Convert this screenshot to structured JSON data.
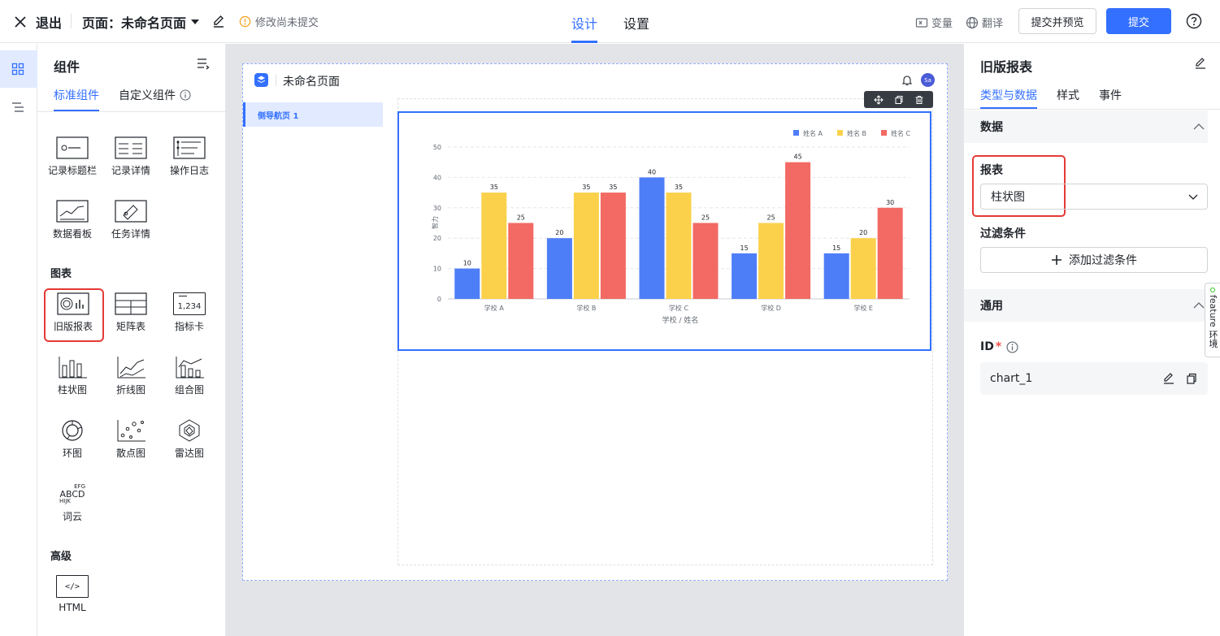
{
  "topbar": {
    "exit_label": "退出",
    "page_prefix": "页面：",
    "page_name": "未命名页面",
    "unsaved": "修改尚未提交",
    "tabs": [
      "设计",
      "设置"
    ],
    "variables": "变量",
    "translate": "翻译",
    "submit_preview": "提交并预览",
    "submit": "提交"
  },
  "left": {
    "title": "组件",
    "tabs": [
      "标准组件",
      "自定义组件"
    ],
    "basic": [
      "记录标题栏",
      "记录详情",
      "操作日志",
      "数据看板",
      "任务详情"
    ],
    "chart_section": "图表",
    "charts": [
      "旧版报表",
      "矩阵表",
      "指标卡",
      "柱状图",
      "折线图",
      "组合图",
      "环图",
      "散点图",
      "雷达图",
      "词云"
    ],
    "advanced_section": "高级",
    "advanced": [
      "HTML"
    ],
    "indicator_text": "1,234",
    "wordcloud_text": [
      "EFG",
      "ABCD",
      "HIJK"
    ],
    "html_icon_text": "</>"
  },
  "canvas": {
    "page_title": "未命名页面",
    "nav_item": "侧导航页 1",
    "avatar": "Sa"
  },
  "chart_data": {
    "type": "bar",
    "categories": [
      "学校 A",
      "学校 B",
      "学校 C",
      "学校 D",
      "学校 E"
    ],
    "series": [
      {
        "name": "姓名 A",
        "color": "#4e7ef7",
        "values": [
          10,
          20,
          40,
          15,
          15
        ]
      },
      {
        "name": "姓名 B",
        "color": "#fbd14b",
        "values": [
          35,
          35,
          35,
          25,
          20
        ]
      },
      {
        "name": "姓名 C",
        "color": "#f26a63",
        "values": [
          25,
          35,
          25,
          45,
          30
        ]
      }
    ],
    "xlabel": "学校 / 姓名",
    "ylabel": "智力",
    "ylim": [
      0,
      50
    ],
    "yticks": [
      "0",
      "10",
      "20",
      "30",
      "40",
      "50"
    ],
    "legend": "top-right"
  },
  "right": {
    "title": "旧版报表",
    "tabs": [
      "类型与数据",
      "样式",
      "事件"
    ],
    "data_section": "数据",
    "report_label": "报表",
    "report_value": "柱状图",
    "filter_label": "过滤条件",
    "add_filter": "添加过滤条件",
    "general_section": "通用",
    "id_label": "ID",
    "id_value": "chart_1",
    "feature_tab": "feature 环境"
  }
}
